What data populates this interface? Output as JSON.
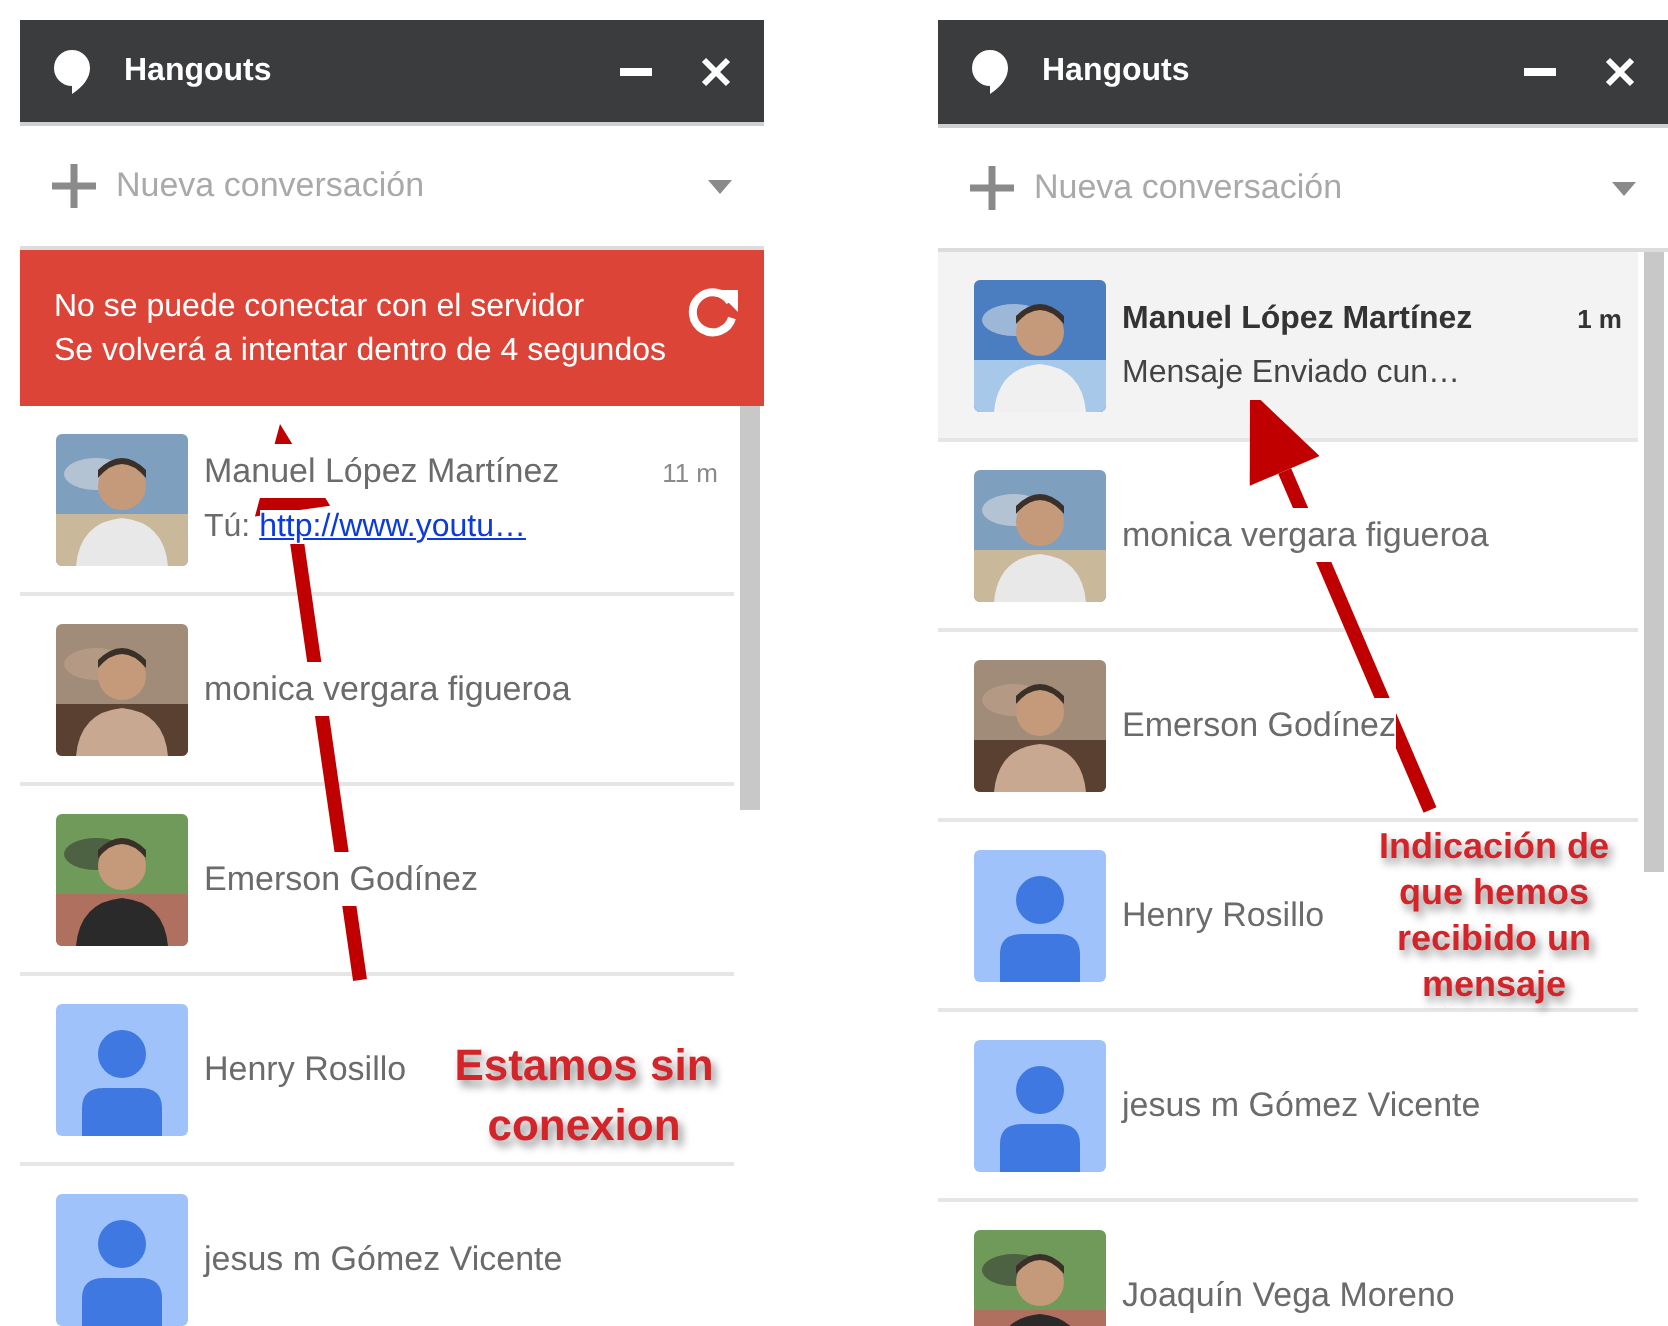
{
  "panels": [
    {
      "title": "Hangouts",
      "new_conversation": "Nueva conversación",
      "banner": {
        "title": "No se puede conectar con el servidor",
        "message": "Se volverá a intentar dentro de 4 segundos"
      },
      "contacts": [
        {
          "name": "Manuel López Martínez",
          "time": "11 m",
          "snippet_prefix": "Tú:",
          "snippet_link": "http://www.youtu…",
          "unread": false
        },
        {
          "name": "monica vergara figueroa",
          "unread": false
        },
        {
          "name": "Emerson Godínez",
          "unread": false
        },
        {
          "name": "Henry Rosillo",
          "kind": "default",
          "unread": false
        },
        {
          "name": "jesus m Gómez Vicente",
          "kind": "default",
          "unread": false
        }
      ],
      "annotation": "Estamos sin conexion"
    },
    {
      "title": "Hangouts",
      "new_conversation": "Nueva conversación",
      "contacts": [
        {
          "name": "Manuel López Martínez",
          "time": "1 m",
          "snippet": "Mensaje Enviado cun…",
          "unread": true
        },
        {
          "name": "monica vergara figueroa",
          "unread": false
        },
        {
          "name": "Emerson Godínez",
          "unread": false
        },
        {
          "name": "Henry Rosillo",
          "kind": "default",
          "unread": false
        },
        {
          "name": "jesus m Gómez Vicente",
          "kind": "default",
          "unread": false
        },
        {
          "name": "Joaquín Vega Moreno",
          "unread": false
        }
      ],
      "annotation": "Indicación de que hemos recibido un mensaje"
    }
  ]
}
